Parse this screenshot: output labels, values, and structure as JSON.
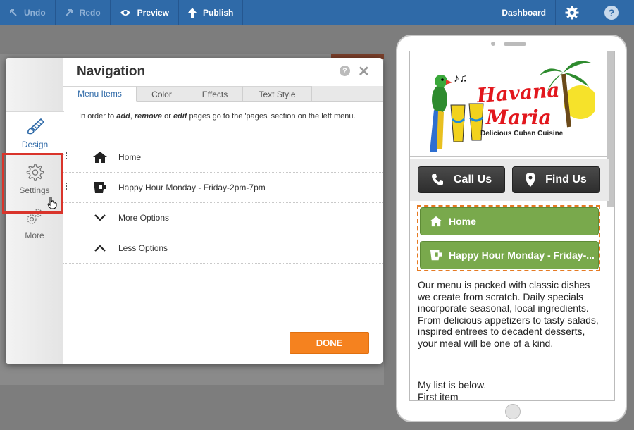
{
  "toolbar": {
    "undo": "Undo",
    "redo": "Redo",
    "preview": "Preview",
    "publish": "Publish",
    "dashboard": "Dashboard",
    "help": "?"
  },
  "sidebar": {
    "items": [
      {
        "label": "Design",
        "icon": "paint-brush-icon"
      },
      {
        "label": "Settings",
        "icon": "gear-icon"
      },
      {
        "label": "More",
        "icon": "gears-icon"
      }
    ]
  },
  "modal": {
    "title": "Navigation",
    "help": "?",
    "close": "✕",
    "tabs": [
      "Menu Items",
      "Color",
      "Effects",
      "Text Style"
    ],
    "hint_prefix": "In order to ",
    "hint_add": "add",
    "hint_sep1": ", ",
    "hint_remove": "remove",
    "hint_sep2": " or ",
    "hint_edit": "edit",
    "hint_suffix": " pages go to the 'pages' section on the left menu.",
    "rows": [
      {
        "label": "Home",
        "icon": "home-icon"
      },
      {
        "label": "Happy Hour Monday - Friday-2pm-7pm",
        "icon": "drink-icon"
      },
      {
        "label": "More Options",
        "icon": "chevron-down-icon"
      },
      {
        "label": "Less Options",
        "icon": "chevron-up-icon"
      }
    ],
    "done": "DONE"
  },
  "phone": {
    "logo_line1": "Havana",
    "logo_line2": "Maria",
    "logo_tagline": "Delicious Cuban Cuisine",
    "call_us": "Call Us",
    "find_us": "Find Us",
    "nav_home": "Home",
    "nav_happy_hour": "Happy Hour Monday - Friday-...",
    "body_paragraph": "Our menu is packed with classic dishes we create from scratch. Daily specials incorporate seasonal, local ingredients. From delicious appetizers to tasty salads, inspired entrees to decadent desserts, your meal will be one of a kind.",
    "list_intro": "My list is below.",
    "first_item": "First item"
  },
  "colors": {
    "toolbar_bg": "#2f6aa8",
    "done_button": "#f5821f",
    "nav_button": "#79a94c",
    "highlight": "#d9342b"
  }
}
